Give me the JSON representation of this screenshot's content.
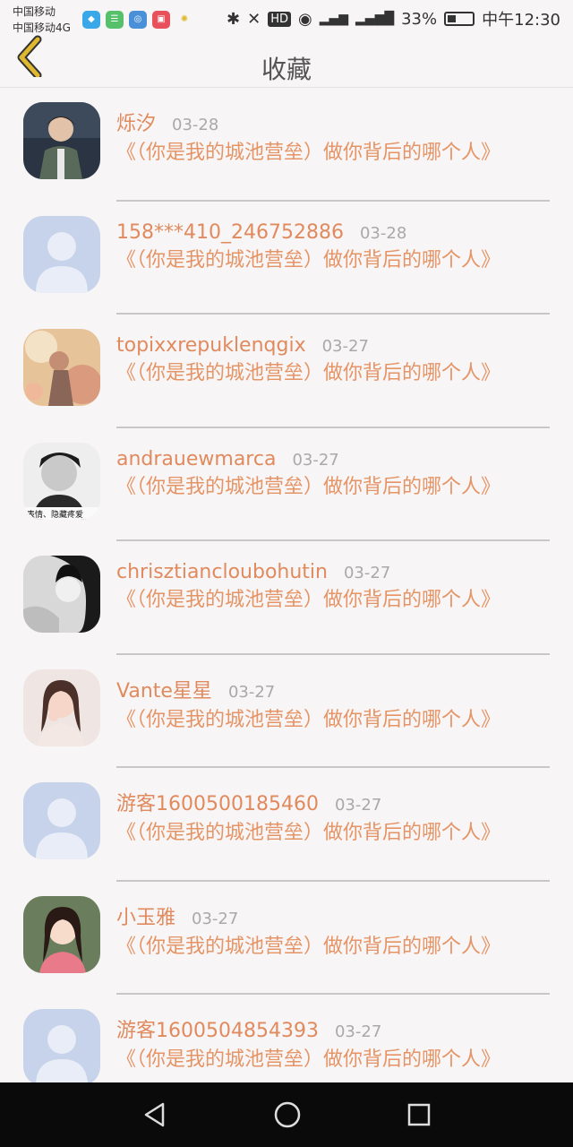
{
  "status_bar": {
    "carrier1": "中国移动",
    "carrier2": "中国移动4G",
    "battery": "33%",
    "battery_level": 0.33,
    "time": "中午12:30"
  },
  "header": {
    "title": "收藏"
  },
  "items": [
    {
      "name": "烁汐",
      "date": "03-28",
      "text": "《（你是我的城池营垒）做你背后的哪个人》",
      "avatar": "photo-boy"
    },
    {
      "name": "158***410_246752886",
      "date": "03-28",
      "text": "《（你是我的城池营垒）做你背后的哪个人》",
      "avatar": "default"
    },
    {
      "name": "topixxrepuklenqgix",
      "date": "03-27",
      "text": "《（你是我的城池营垒）做你背后的哪个人》",
      "avatar": "photo-field"
    },
    {
      "name": "andrauewmarca",
      "date": "03-27",
      "text": "《（你是我的城池营垒）做你背后的哪个人》",
      "avatar": "photo-bw-boy"
    },
    {
      "name": "chrisztiancloubohutin",
      "date": "03-27",
      "text": "《（你是我的城池营垒）做你背后的哪个人》",
      "avatar": "photo-bw-girl"
    },
    {
      "name": "Vante星星",
      "date": "03-27",
      "text": "《（你是我的城池营垒）做你背后的哪个人》",
      "avatar": "photo-girl"
    },
    {
      "name": "游客1600500185460",
      "date": "03-27",
      "text": "《（你是我的城池营垒）做你背后的哪个人》",
      "avatar": "default"
    },
    {
      "name": "小玉雅",
      "date": "03-27",
      "text": "《（你是我的城池营垒）做你背后的哪个人》",
      "avatar": "photo-girl2"
    },
    {
      "name": "游客1600504854393",
      "date": "03-27",
      "text": "《（你是我的城池营垒）做你背后的哪个人》",
      "avatar": "default"
    }
  ],
  "colors": {
    "name": "#e08a5e",
    "text": "#e59465",
    "date": "#a9a9a9",
    "back": "#e0b830"
  }
}
